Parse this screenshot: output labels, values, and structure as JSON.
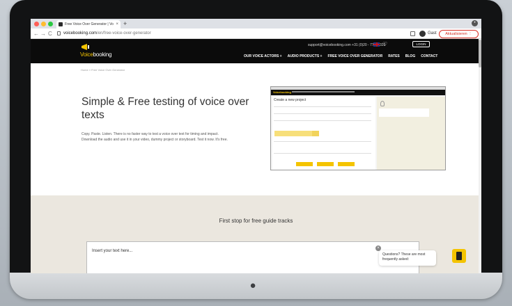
{
  "browser": {
    "tab_title": "Free Voice Over Generator | Vo",
    "url_host": "voicebooking.com",
    "url_path": "/en/free-voice-over-generator",
    "guest_label": "Gast",
    "update_label": "Aktualisieren"
  },
  "header": {
    "logo_text": "booking",
    "logo_accent": "Voice",
    "contact": "support@voicebooking.com  +31 (0)20 - 77 47 323",
    "login_label": "LOGIN",
    "nav": [
      "OUR VOICE ACTORS +",
      "AUDIO PRODUCTS +",
      "FREE VOICE OVER GENERATOR",
      "RATES",
      "BLOG",
      "CONTACT"
    ]
  },
  "breadcrumb": "Home » Free Voice Over Generator",
  "hero": {
    "title": "Simple & Free testing of voice over texts",
    "text": "Copy. Paste. Listen. There is no faster way to test a voice over text for timing and impact. Download the audio and use it in your video, dummy project or storyboard. Test it now. It's free."
  },
  "preview": {
    "logo": "Voicebooking",
    "title": "Create a new project"
  },
  "section": {
    "title": "First stop for free guide tracks",
    "input_placeholder": "Insert your text here...",
    "faq_text": "Questions? These are most frequently asked:"
  },
  "colors": {
    "accent": "#f4c400",
    "header_bg": "#0b0b0b",
    "band_bg": "#ebe7df"
  }
}
